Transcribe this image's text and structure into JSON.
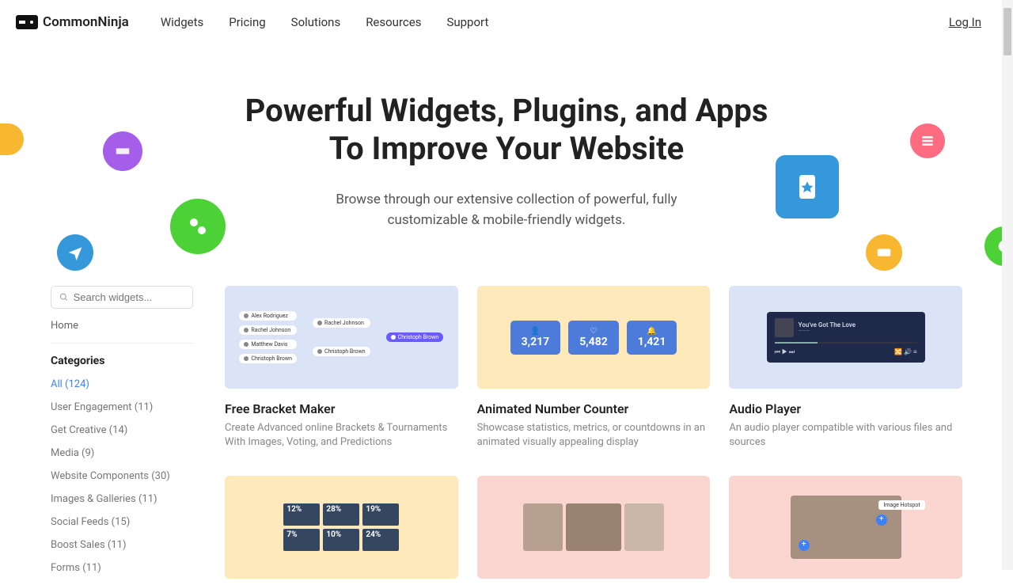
{
  "header": {
    "logo": "CommonNinja",
    "nav": [
      "Widgets",
      "Pricing",
      "Solutions",
      "Resources",
      "Support"
    ],
    "login": "Log In"
  },
  "hero": {
    "title_line1": "Powerful Widgets, Plugins, and Apps",
    "title_line2": "To Improve Your Website",
    "subtitle_line1": "Browse through our extensive collection of powerful, fully",
    "subtitle_line2": "customizable & mobile-friendly widgets."
  },
  "sidebar": {
    "search_placeholder": "Search widgets...",
    "home": "Home",
    "categories_label": "Categories",
    "categories": [
      {
        "label": "All (124)",
        "active": true
      },
      {
        "label": "User Engagement (11)"
      },
      {
        "label": "Get Creative (14)"
      },
      {
        "label": "Media (9)"
      },
      {
        "label": "Website Components (30)"
      },
      {
        "label": "Images & Galleries (11)"
      },
      {
        "label": "Social Feeds (15)"
      },
      {
        "label": "Boost Sales (11)"
      },
      {
        "label": "Forms (11)"
      }
    ]
  },
  "cards": [
    {
      "title": "Free Bracket Maker",
      "desc": "Create Advanced online Brackets & Tournaments With Images, Voting, and Predictions",
      "bracket_names": [
        "Alex Rodriguez",
        "Rachel Johnson",
        "Matthew Davis",
        "Christoph Brown",
        "Rachel Johnson",
        "Christoph Brown",
        "Christoph Brown"
      ]
    },
    {
      "title": "Animated Number Counter",
      "desc": "Showcase statistics, metrics, or countdowns in an animated visually appealing display",
      "counters": [
        "3,217",
        "5,482",
        "1,421"
      ]
    },
    {
      "title": "Audio Player",
      "desc": "An audio player compatible with various files and sources",
      "track": "You've Got The Love"
    }
  ],
  "cards_row2_bars": [
    "12%",
    "28%",
    "19%",
    "7%",
    "10%",
    "24%"
  ]
}
